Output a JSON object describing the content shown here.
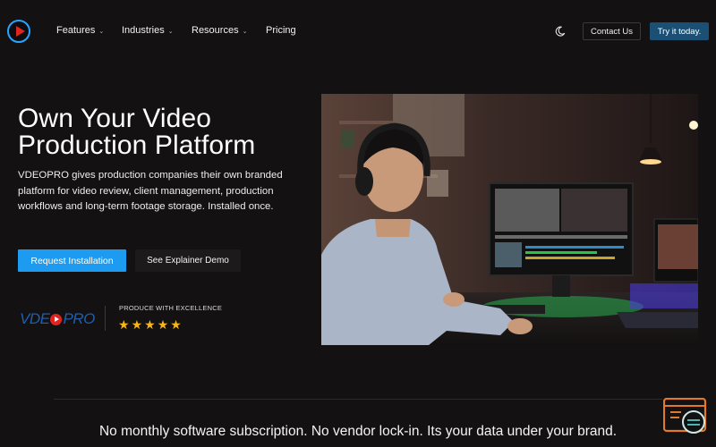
{
  "nav": {
    "items": [
      {
        "label": "Features",
        "has_dropdown": true
      },
      {
        "label": "Industries",
        "has_dropdown": true
      },
      {
        "label": "Resources",
        "has_dropdown": true
      },
      {
        "label": "Pricing",
        "has_dropdown": false
      }
    ],
    "contact_label": "Contact Us",
    "try_label": "Try it today."
  },
  "hero": {
    "title": "Own Your Video Production Platform",
    "description": "VDEOPRO gives production companies their own branded platform for video review, client management, production workflows and long-term footage storage. Installed once.",
    "primary_button": "Request Installation",
    "secondary_button": "See Explainer Demo",
    "brand_logo": {
      "left": "VDE",
      "right": "PRO"
    },
    "excellence_label": "PRODUCE WITH EXCELLENCE",
    "rating": 5
  },
  "tagline": "No monthly software subscription. No vendor lock-in. Its your data under your brand.",
  "colors": {
    "background": "#131111",
    "accent_blue": "#1d9bf0",
    "try_button": "#1b4f74",
    "star": "#f6b51a",
    "logo_red": "#e0241f"
  },
  "icons": {
    "logo": "play-circle-icon",
    "theme": "moon-icon",
    "chat": "chat-support-icon"
  }
}
